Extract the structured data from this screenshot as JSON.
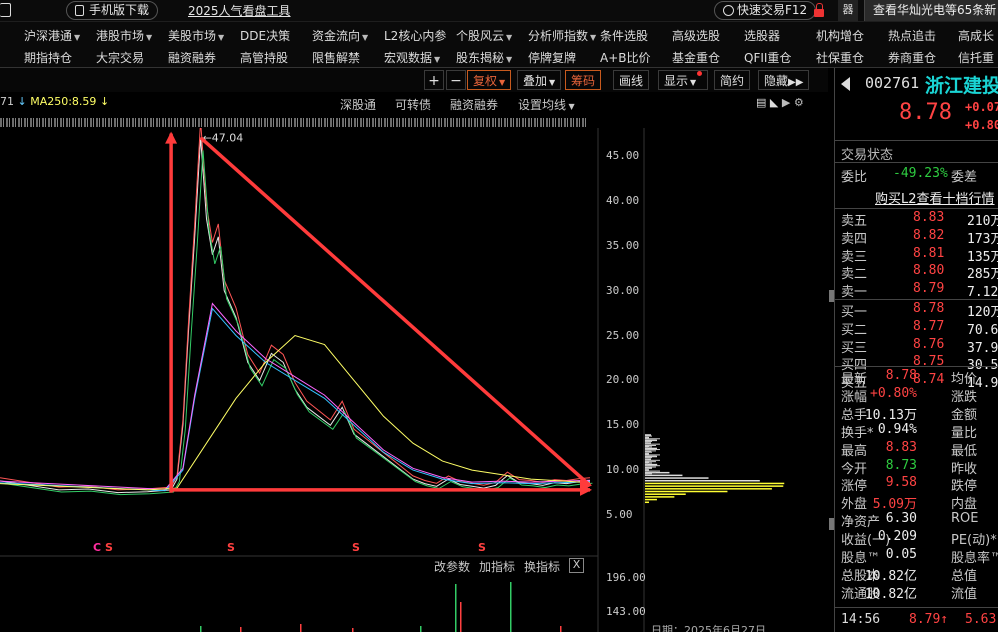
{
  "topbar": {
    "mobile_download": "手机版下载",
    "popular_tool": "2025人气看盘工具",
    "quick_trade": "快速交易F12",
    "news": "查看华灿光电等65条新",
    "grid_label": "器"
  },
  "menu": {
    "row1": [
      "沪深港通",
      "港股市场",
      "美股市场",
      "DDE决策",
      "资金流向",
      "L2核心内参",
      "个股风云",
      "分析师指数",
      "条件选股",
      "高级选股",
      "选股器",
      "机构增仓",
      "热点追击",
      "高成长"
    ],
    "row1_dropdown": [
      true,
      true,
      true,
      false,
      true,
      false,
      true,
      true,
      false,
      false,
      false,
      false,
      false,
      false
    ],
    "row2": [
      "期指持仓",
      "大宗交易",
      "融资融券",
      "高管持股",
      "限售解禁",
      "宏观数据",
      "股东揭秘",
      "停牌复牌",
      "A+B比价",
      "基金重仓",
      "QFII重仓",
      "社保重仓",
      "券商重仓",
      "信托重"
    ],
    "row2_dropdown": [
      false,
      false,
      false,
      false,
      false,
      true,
      true,
      false,
      false,
      false,
      false,
      false,
      false,
      false
    ]
  },
  "chart_toolbar": {
    "plus": "+",
    "minus": "−",
    "restore": "复权",
    "overlay": "叠加",
    "chips": "筹码",
    "draw_line": "画线",
    "display": "显示",
    "simple": "简约",
    "hide": "隐藏"
  },
  "ma_legend": {
    "prefix": "71",
    "ma250_label": "MA250:8.59"
  },
  "chart_links": {
    "shenzhen_connect": "深股通",
    "convertible": "可转债",
    "margin": "融资融券",
    "set_ma": "设置均线"
  },
  "indicator_bar": {
    "params": "改参数",
    "add": "加指标",
    "switch": "换指标",
    "close": "X"
  },
  "date_label": "日期：2025年6月27日",
  "signals": [
    {
      "label": "C",
      "color": "#ff2ea0"
    },
    {
      "label": "S",
      "color": "#ff4040"
    },
    {
      "label": "S",
      "color": "#ff4040"
    },
    {
      "label": "S",
      "color": "#ff4040"
    },
    {
      "label": "S",
      "color": "#ff4040"
    }
  ],
  "stock": {
    "code": "002761",
    "name": "浙江建投",
    "price": "8.78",
    "change": "+0.07",
    "change_pct": "+0.80"
  },
  "panel": {
    "section": "交易状态",
    "commit_ratio_label": "委比",
    "commit_ratio_value": "-49.23%",
    "commit_diff_label": "委差",
    "buy_l2": "购买L2查看十档行情"
  },
  "orderbook": {
    "sell": [
      {
        "name": "卖五",
        "price": "8.83",
        "vol": "210万"
      },
      {
        "name": "卖四",
        "price": "8.82",
        "vol": "173万"
      },
      {
        "name": "卖三",
        "price": "8.81",
        "vol": "135万"
      },
      {
        "name": "卖二",
        "price": "8.80",
        "vol": "285万"
      },
      {
        "name": "卖一",
        "price": "8.79",
        "vol": "7.12万"
      }
    ],
    "buy": [
      {
        "name": "买一",
        "price": "8.78",
        "vol": "120万"
      },
      {
        "name": "买二",
        "price": "8.77",
        "vol": "70.6万"
      },
      {
        "name": "买三",
        "price": "8.76",
        "vol": "37.9万"
      },
      {
        "name": "买四",
        "price": "8.75",
        "vol": "30.5万"
      },
      {
        "name": "买五",
        "price": "8.74",
        "vol": "14.9万"
      }
    ]
  },
  "stats": [
    {
      "l1": "最新",
      "v1": "8.78",
      "c": "r",
      "l2": "均价"
    },
    {
      "l1": "涨幅",
      "v1": "+0.80%",
      "c": "r",
      "l2": "涨跌"
    },
    {
      "l1": "总手",
      "v1": "10.13万",
      "c": "w",
      "l2": "金额"
    },
    {
      "l1": "换手*",
      "v1": "0.94%",
      "c": "w",
      "l2": "量比"
    },
    {
      "l1": "最高",
      "v1": "8.83",
      "c": "r",
      "l2": "最低"
    },
    {
      "l1": "今开",
      "v1": "8.73",
      "c": "g",
      "l2": "昨收"
    },
    {
      "l1": "涨停",
      "v1": "9.58",
      "c": "r",
      "l2": "跌停"
    },
    {
      "l1": "外盘",
      "v1": "5.09万",
      "c": "r",
      "l2": "内盘"
    },
    {
      "l1": "净资产",
      "v1": "6.30",
      "c": "w",
      "l2": "ROE"
    },
    {
      "l1": "收益(一)",
      "v1": "0.209",
      "c": "w",
      "l2": "PE(动)*"
    },
    {
      "l1": "股息™",
      "v1": "0.05",
      "c": "w",
      "l2": "股息率™"
    },
    {
      "l1": "总股本",
      "v1": "10.82亿",
      "c": "w",
      "l2": "总值"
    },
    {
      "l1": "流通股",
      "v1": "10.82亿",
      "c": "w",
      "l2": "流值"
    }
  ],
  "footer": {
    "time": "14:56",
    "price": "8.79↑",
    "vol": "5.63万"
  },
  "chart_data": {
    "type": "line",
    "title": "",
    "series": [
      {
        "name": "MA250",
        "color": "#ffff66",
        "values": [
          8.59
        ]
      }
    ],
    "y_ticks": [
      5.0,
      10.0,
      15.0,
      20.0,
      25.0,
      30.0,
      35.0,
      40.0,
      45.0
    ],
    "ylim": [
      3.0,
      49.5
    ],
    "annotations": [
      {
        "text": "47.04",
        "value": 47.04
      }
    ],
    "volume_ticks": [
      143.0,
      196.0
    ],
    "price_path": [
      [
        0,
        8.8
      ],
      [
        0.05,
        8.3
      ],
      [
        0.1,
        7.8
      ],
      [
        0.15,
        7.9
      ],
      [
        0.2,
        7.5
      ],
      [
        0.25,
        7.6
      ],
      [
        0.29,
        7.8
      ],
      [
        0.3,
        9
      ],
      [
        0.31,
        15
      ],
      [
        0.32,
        26
      ],
      [
        0.33,
        36
      ],
      [
        0.34,
        47.04
      ],
      [
        0.35,
        38
      ],
      [
        0.36,
        34
      ],
      [
        0.37,
        36
      ],
      [
        0.38,
        30
      ],
      [
        0.4,
        27
      ],
      [
        0.42,
        22
      ],
      [
        0.44,
        20
      ],
      [
        0.46,
        23
      ],
      [
        0.48,
        22
      ],
      [
        0.5,
        19
      ],
      [
        0.52,
        17
      ],
      [
        0.54,
        16
      ],
      [
        0.56,
        15
      ],
      [
        0.58,
        17
      ],
      [
        0.6,
        14
      ],
      [
        0.62,
        13
      ],
      [
        0.64,
        12
      ],
      [
        0.66,
        11
      ],
      [
        0.68,
        10
      ],
      [
        0.7,
        9
      ],
      [
        0.72,
        8.5
      ],
      [
        0.74,
        8.2
      ],
      [
        0.76,
        9
      ],
      [
        0.78,
        8.4
      ],
      [
        0.8,
        8.2
      ],
      [
        0.82,
        8.0
      ],
      [
        0.84,
        8.3
      ],
      [
        0.86,
        9.4
      ],
      [
        0.88,
        8.6
      ],
      [
        0.9,
        8.5
      ],
      [
        0.92,
        8.3
      ],
      [
        0.94,
        8.6
      ],
      [
        0.96,
        8.5
      ],
      [
        0.98,
        8.7
      ],
      [
        1.0,
        8.8
      ]
    ],
    "slow_ma_path": [
      [
        0,
        8.5
      ],
      [
        0.25,
        7.8
      ],
      [
        0.3,
        8.0
      ],
      [
        0.35,
        13
      ],
      [
        0.4,
        18
      ],
      [
        0.45,
        22
      ],
      [
        0.5,
        25
      ],
      [
        0.55,
        24
      ],
      [
        0.6,
        20
      ],
      [
        0.65,
        16
      ],
      [
        0.7,
        13
      ],
      [
        0.75,
        11
      ],
      [
        0.8,
        10
      ],
      [
        0.85,
        9.5
      ],
      [
        0.9,
        9.0
      ],
      [
        0.95,
        8.8
      ],
      [
        1.0,
        8.6
      ]
    ],
    "mid_ma_path": [
      [
        0,
        8.6
      ],
      [
        0.28,
        7.7
      ],
      [
        0.31,
        10
      ],
      [
        0.33,
        18
      ],
      [
        0.36,
        28
      ],
      [
        0.4,
        25
      ],
      [
        0.45,
        22
      ],
      [
        0.5,
        20
      ],
      [
        0.55,
        18
      ],
      [
        0.6,
        15
      ],
      [
        0.65,
        12
      ],
      [
        0.7,
        10
      ],
      [
        0.75,
        9
      ],
      [
        0.8,
        8.5
      ],
      [
        0.85,
        8.6
      ],
      [
        0.9,
        8.5
      ],
      [
        1.0,
        8.7
      ]
    ],
    "trend_lines": [
      {
        "name": "apex-up",
        "from": [
          0.29,
          7.5
        ],
        "to": [
          0.29,
          47.5
        ]
      },
      {
        "name": "upper",
        "from": [
          0.34,
          47.04
        ],
        "to": [
          1.0,
          8.3
        ]
      },
      {
        "name": "base",
        "from": [
          0.29,
          7.8
        ],
        "to": [
          1.0,
          7.8
        ]
      }
    ]
  }
}
